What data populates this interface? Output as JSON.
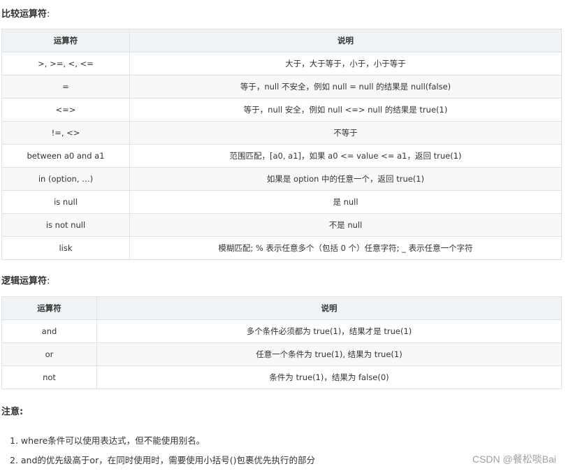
{
  "section1": {
    "title": "比较运算符",
    "colon": ":",
    "headers": [
      "运算符",
      "说明"
    ],
    "rows": [
      [
        ">, >=, <, <=",
        "大于，大于等于，小于，小于等于"
      ],
      [
        "=",
        "等于，null 不安全，例如 null = null 的结果是 null(false)"
      ],
      [
        "<=>",
        "等于，null 安全，例如 null <=> null 的结果是 true(1)"
      ],
      [
        "!=, <>",
        "不等于"
      ],
      [
        "between a0 and a1",
        "范围匹配，[a0, a1]，如果 a0 <= value <= a1，返回 true(1)"
      ],
      [
        "in (option, …)",
        "如果是 option 中的任意一个，返回 true(1)"
      ],
      [
        "is null",
        "是 null"
      ],
      [
        "is not null",
        "不是 null"
      ],
      [
        "lisk",
        "模糊匹配; % 表示任意多个（包括 0 个）任意字符; _ 表示任意一个字符"
      ]
    ]
  },
  "section2": {
    "title": "逻辑运算符",
    "colon": ":",
    "headers": [
      "运算符",
      "说明"
    ],
    "rows": [
      [
        "and",
        "多个条件必须都为 true(1)，结果才是 true(1)"
      ],
      [
        "or",
        "任意一个条件为 true(1), 结果为 true(1)"
      ],
      [
        "not",
        "条件为 true(1)，结果为 false(0)"
      ]
    ]
  },
  "notes": {
    "title": "注意:",
    "items": [
      "1. where条件可以使用表达式，但不能使用别名。",
      "2. and的优先级高于or，在同时使用时，需要使用小括号()包裹优先执行的部分"
    ]
  },
  "watermark": "CSDN @餐松啖Bai"
}
